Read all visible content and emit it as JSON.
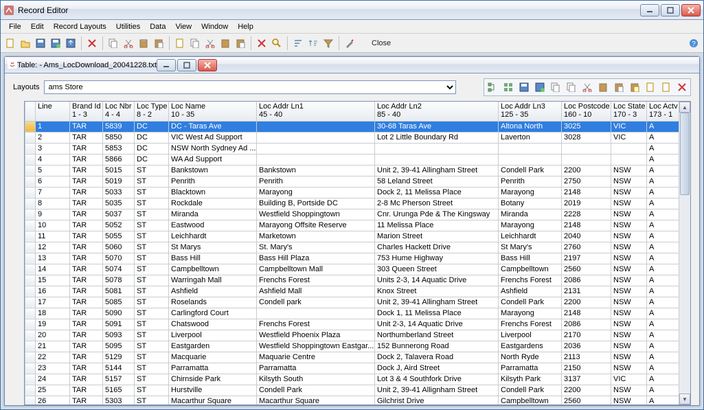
{
  "outer": {
    "title": "Record Editor"
  },
  "menus": [
    "File",
    "Edit",
    "Record Layouts",
    "Utilities",
    "Data",
    "View",
    "Window",
    "Help"
  ],
  "toolbar_close": "Close",
  "inner": {
    "title": "Table: - Ams_LocDownload_20041228.txt"
  },
  "layouts": {
    "label": "Layouts",
    "value": "ams Store"
  },
  "columns": [
    {
      "h1": "",
      "h2": "",
      "cls": "col-chk"
    },
    {
      "h1": "Line",
      "h2": "",
      "cls": "col-line"
    },
    {
      "h1": "Brand Id",
      "h2": "1 - 3",
      "cls": "col-brand"
    },
    {
      "h1": "Loc Nbr",
      "h2": "4 - 4",
      "cls": "col-locnbr"
    },
    {
      "h1": "Loc Type",
      "h2": "8 - 2",
      "cls": "col-loctype"
    },
    {
      "h1": "Loc Name",
      "h2": "10 - 35",
      "cls": "col-locname"
    },
    {
      "h1": "Loc Addr Ln1",
      "h2": "45 - 40",
      "cls": "col-addr1"
    },
    {
      "h1": "Loc Addr Ln2",
      "h2": "85 - 40",
      "cls": "col-addr2"
    },
    {
      "h1": "Loc Addr Ln3",
      "h2": "125 - 35",
      "cls": "col-addr3"
    },
    {
      "h1": "Loc Postcode",
      "h2": "160 - 10",
      "cls": "col-postcode"
    },
    {
      "h1": "Loc State",
      "h2": "170 - 3",
      "cls": "col-state"
    },
    {
      "h1": "Loc Actv Ind",
      "h2": "173 - 1",
      "cls": "col-actv"
    }
  ],
  "rows": [
    {
      "line": "1",
      "brand": "TAR",
      "nbr": "5839",
      "type": "DC",
      "name": "DC - Taras Ave",
      "a1": "",
      "a2": "30-68 Taras Ave",
      "a3": "Altona North",
      "pc": "3025",
      "st": "VIC",
      "ac": "A",
      "sel": true
    },
    {
      "line": "2",
      "brand": "TAR",
      "nbr": "5850",
      "type": "DC",
      "name": "VIC West Ad Support",
      "a1": "",
      "a2": "Lot 2 Little Boundary Rd",
      "a3": "Laverton",
      "pc": "3028",
      "st": "VIC",
      "ac": "A"
    },
    {
      "line": "3",
      "brand": "TAR",
      "nbr": "5853",
      "type": "DC",
      "name": "NSW North Sydney Ad ...",
      "a1": "",
      "a2": "",
      "a3": "",
      "pc": "",
      "st": "",
      "ac": "A"
    },
    {
      "line": "4",
      "brand": "TAR",
      "nbr": "5866",
      "type": "DC",
      "name": "WA Ad Support",
      "a1": "",
      "a2": "",
      "a3": "",
      "pc": "",
      "st": "",
      "ac": "A"
    },
    {
      "line": "5",
      "brand": "TAR",
      "nbr": "5015",
      "type": "ST",
      "name": "Bankstown",
      "a1": "Bankstown",
      "a2": "Unit 2, 39-41 Allingham Street",
      "a3": "Condell Park",
      "pc": "2200",
      "st": "NSW",
      "ac": "A"
    },
    {
      "line": "6",
      "brand": "TAR",
      "nbr": "5019",
      "type": "ST",
      "name": "Penrith",
      "a1": "Penrith",
      "a2": "58 Leland Street",
      "a3": "Penrith",
      "pc": "2750",
      "st": "NSW",
      "ac": "A"
    },
    {
      "line": "7",
      "brand": "TAR",
      "nbr": "5033",
      "type": "ST",
      "name": "Blacktown",
      "a1": "Marayong",
      "a2": "Dock 2, 11 Melissa Place",
      "a3": "Marayong",
      "pc": "2148",
      "st": "NSW",
      "ac": "A"
    },
    {
      "line": "8",
      "brand": "TAR",
      "nbr": "5035",
      "type": "ST",
      "name": "Rockdale",
      "a1": "Building B,  Portside DC",
      "a2": "2-8 Mc Pherson Street",
      "a3": "Botany",
      "pc": "2019",
      "st": "NSW",
      "ac": "A"
    },
    {
      "line": "9",
      "brand": "TAR",
      "nbr": "5037",
      "type": "ST",
      "name": "Miranda",
      "a1": "Westfield Shoppingtown",
      "a2": "Cnr. Urunga Pde & The Kingsway",
      "a3": "Miranda",
      "pc": "2228",
      "st": "NSW",
      "ac": "A"
    },
    {
      "line": "10",
      "brand": "TAR",
      "nbr": "5052",
      "type": "ST",
      "name": "Eastwood",
      "a1": "Marayong Offsite Reserve",
      "a2": "11 Melissa Place",
      "a3": "Marayong",
      "pc": "2148",
      "st": "NSW",
      "ac": "A"
    },
    {
      "line": "11",
      "brand": "TAR",
      "nbr": "5055",
      "type": "ST",
      "name": "Leichhardt",
      "a1": "Marketown",
      "a2": "Marion Street",
      "a3": "Leichhardt",
      "pc": "2040",
      "st": "NSW",
      "ac": "A"
    },
    {
      "line": "12",
      "brand": "TAR",
      "nbr": "5060",
      "type": "ST",
      "name": "St Marys",
      "a1": "St. Mary's",
      "a2": "Charles Hackett Drive",
      "a3": "St Mary's",
      "pc": "2760",
      "st": "NSW",
      "ac": "A"
    },
    {
      "line": "13",
      "brand": "TAR",
      "nbr": "5070",
      "type": "ST",
      "name": "Bass Hill",
      "a1": "Bass Hill Plaza",
      "a2": "753 Hume Highway",
      "a3": "Bass Hill",
      "pc": "2197",
      "st": "NSW",
      "ac": "A"
    },
    {
      "line": "14",
      "brand": "TAR",
      "nbr": "5074",
      "type": "ST",
      "name": "Campbelltown",
      "a1": "Campbelltown Mall",
      "a2": "303 Queen Street",
      "a3": "Campbelltown",
      "pc": "2560",
      "st": "NSW",
      "ac": "A"
    },
    {
      "line": "15",
      "brand": "TAR",
      "nbr": "5078",
      "type": "ST",
      "name": "Warringah Mall",
      "a1": "Frenchs Forest",
      "a2": "Units 2-3, 14 Aquatic Drive",
      "a3": "Frenchs Forest",
      "pc": "2086",
      "st": "NSW",
      "ac": "A"
    },
    {
      "line": "16",
      "brand": "TAR",
      "nbr": "5081",
      "type": "ST",
      "name": "Ashfield",
      "a1": "Ashfield Mall",
      "a2": "Knox Street",
      "a3": "Ashfield",
      "pc": "2131",
      "st": "NSW",
      "ac": "A"
    },
    {
      "line": "17",
      "brand": "TAR",
      "nbr": "5085",
      "type": "ST",
      "name": "Roselands",
      "a1": "Condell park",
      "a2": "Unit 2, 39-41 Allingham Street",
      "a3": "Condell Park",
      "pc": "2200",
      "st": "NSW",
      "ac": "A"
    },
    {
      "line": "18",
      "brand": "TAR",
      "nbr": "5090",
      "type": "ST",
      "name": "Carlingford Court",
      "a1": "",
      "a2": "Dock 1, 11 Melissa Place",
      "a3": "Marayong",
      "pc": "2148",
      "st": "NSW",
      "ac": "A"
    },
    {
      "line": "19",
      "brand": "TAR",
      "nbr": "5091",
      "type": "ST",
      "name": "Chatswood",
      "a1": "Frenchs Forest",
      "a2": "Unit 2-3, 14 Aquatic Drive",
      "a3": "Frenchs Forest",
      "pc": "2086",
      "st": "NSW",
      "ac": "A"
    },
    {
      "line": "20",
      "brand": "TAR",
      "nbr": "5093",
      "type": "ST",
      "name": "Liverpool",
      "a1": "Westfield Phoenix Plaza",
      "a2": "Northumberland Street",
      "a3": "Liverpool",
      "pc": "2170",
      "st": "NSW",
      "ac": "A"
    },
    {
      "line": "21",
      "brand": "TAR",
      "nbr": "5095",
      "type": "ST",
      "name": "Eastgarden",
      "a1": "Westfield Shoppingtown Eastgar...",
      "a2": "152 Bunnerong Road",
      "a3": "Eastgardens",
      "pc": "2036",
      "st": "NSW",
      "ac": "A"
    },
    {
      "line": "22",
      "brand": "TAR",
      "nbr": "5129",
      "type": "ST",
      "name": "Macquarie",
      "a1": "Maquarie Centre",
      "a2": "Dock 2, Talavera Road",
      "a3": " North Ryde",
      "pc": "2113",
      "st": "NSW",
      "ac": "A"
    },
    {
      "line": "23",
      "brand": "TAR",
      "nbr": "5144",
      "type": "ST",
      "name": "Parramatta",
      "a1": "Parramatta",
      "a2": "Dock J, Aird Street",
      "a3": "Parramatta",
      "pc": "2150",
      "st": "NSW",
      "ac": "A"
    },
    {
      "line": "24",
      "brand": "TAR",
      "nbr": "5157",
      "type": "ST",
      "name": "Chirnside Park",
      "a1": "Kilsyth South",
      "a2": "Lot 3 & 4 Southfork Drive",
      "a3": "Kilsyth Park",
      "pc": "3137",
      "st": "VIC",
      "ac": "A"
    },
    {
      "line": "25",
      "brand": "TAR",
      "nbr": "5165",
      "type": "ST",
      "name": "Hurstville",
      "a1": "Condell Park",
      "a2": "Unit 2, 39-41 Allignham Street",
      "a3": "Condell Park",
      "pc": "2200",
      "st": "NSW",
      "ac": "A"
    },
    {
      "line": "26",
      "brand": "TAR",
      "nbr": "5303",
      "type": "ST",
      "name": "Macarthur Square",
      "a1": "Macarthur Square",
      "a2": "Gilchrist Drive",
      "a3": "Campbelltown",
      "pc": "2560",
      "st": "NSW",
      "ac": "A"
    }
  ]
}
